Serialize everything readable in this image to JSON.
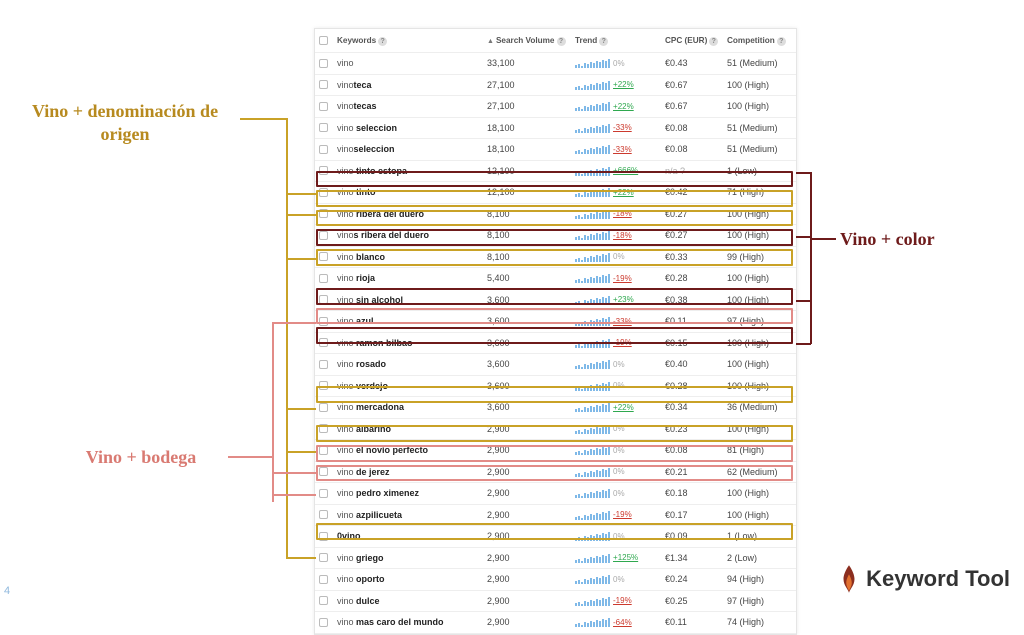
{
  "labels": {
    "denominacion": "Vino + denominación de origen",
    "bodega": "Vino + bodega",
    "color": "Vino + color"
  },
  "header": {
    "keywords": "Keywords",
    "search_volume": "Search Volume",
    "trend": "Trend",
    "cpc": "CPC (EUR)",
    "competition": "Competition"
  },
  "rows": [
    {
      "plain": "vino",
      "bold": "",
      "vol": "33,100",
      "trend_pct": "0%",
      "trend_dir": "0",
      "cpc": "€0.43",
      "comp": "51 (Medium)",
      "hl": ""
    },
    {
      "plain": "vino",
      "bold": "teca",
      "vol": "27,100",
      "trend_pct": "+22%",
      "trend_dir": "up",
      "cpc": "€0.67",
      "comp": "100 (High)",
      "hl": ""
    },
    {
      "plain": "vino",
      "bold": "tecas",
      "vol": "27,100",
      "trend_pct": "+22%",
      "trend_dir": "up",
      "cpc": "€0.67",
      "comp": "100 (High)",
      "hl": ""
    },
    {
      "plain": "vino ",
      "bold": "seleccion",
      "vol": "18,100",
      "trend_pct": "-33%",
      "trend_dir": "dn",
      "cpc": "€0.08",
      "comp": "51 (Medium)",
      "hl": ""
    },
    {
      "plain": "vino",
      "bold": "seleccion",
      "vol": "18,100",
      "trend_pct": "-33%",
      "trend_dir": "dn",
      "cpc": "€0.08",
      "comp": "51 (Medium)",
      "hl": ""
    },
    {
      "plain": "vino ",
      "bold": "tinto estopa",
      "vol": "12,100",
      "trend_pct": "+666%",
      "trend_dir": "up",
      "cpc": "n/a ?",
      "comp": "1 (Low)",
      "hl": ""
    },
    {
      "plain": "vino ",
      "bold": "tinto",
      "vol": "12,100",
      "trend_pct": "+22%",
      "trend_dir": "up",
      "cpc": "€0.42",
      "comp": "71 (High)",
      "hl": "darkred"
    },
    {
      "plain": "vino ",
      "bold": "ribera del duero",
      "vol": "8,100",
      "trend_pct": "-18%",
      "trend_dir": "dn",
      "cpc": "€0.27",
      "comp": "100 (High)",
      "hl": "gold"
    },
    {
      "plain": "vino",
      "bold": "s ribera del duero",
      "vol": "8,100",
      "trend_pct": "-18%",
      "trend_dir": "dn",
      "cpc": "€0.27",
      "comp": "100 (High)",
      "hl": "gold"
    },
    {
      "plain": "vino ",
      "bold": "blanco",
      "vol": "8,100",
      "trend_pct": "0%",
      "trend_dir": "0",
      "cpc": "€0.33",
      "comp": "99 (High)",
      "hl": "darkred"
    },
    {
      "plain": "vino ",
      "bold": "rioja",
      "vol": "5,400",
      "trend_pct": "-19%",
      "trend_dir": "dn",
      "cpc": "€0.28",
      "comp": "100 (High)",
      "hl": "gold"
    },
    {
      "plain": "vino ",
      "bold": "sin alcohol",
      "vol": "3,600",
      "trend_pct": "+23%",
      "trend_dir": "up",
      "cpc": "€0.38",
      "comp": "100 (High)",
      "hl": ""
    },
    {
      "plain": "vino ",
      "bold": "azul",
      "vol": "3,600",
      "trend_pct": "-33%",
      "trend_dir": "dn",
      "cpc": "€0.11",
      "comp": "97 (High)",
      "hl": "darkred"
    },
    {
      "plain": "vino ",
      "bold": "ramon bilbao",
      "vol": "3,600",
      "trend_pct": "-19%",
      "trend_dir": "dn",
      "cpc": "€0.15",
      "comp": "100 (High)",
      "hl": "salmon"
    },
    {
      "plain": "vino ",
      "bold": "rosado",
      "vol": "3,600",
      "trend_pct": "0%",
      "trend_dir": "0",
      "cpc": "€0.40",
      "comp": "100 (High)",
      "hl": "darkred"
    },
    {
      "plain": "vino ",
      "bold": "verdejo",
      "vol": "3,600",
      "trend_pct": "0%",
      "trend_dir": "0",
      "cpc": "€0.28",
      "comp": "100 (High)",
      "hl": ""
    },
    {
      "plain": "vino ",
      "bold": "mercadona",
      "vol": "3,600",
      "trend_pct": "+22%",
      "trend_dir": "up",
      "cpc": "€0.34",
      "comp": "36 (Medium)",
      "hl": ""
    },
    {
      "plain": "vino ",
      "bold": "albariño",
      "vol": "2,900",
      "trend_pct": "0%",
      "trend_dir": "0",
      "cpc": "€0.23",
      "comp": "100 (High)",
      "hl": "gold"
    },
    {
      "plain": "vino ",
      "bold": "el novio perfecto",
      "vol": "2,900",
      "trend_pct": "0%",
      "trend_dir": "0",
      "cpc": "€0.08",
      "comp": "81 (High)",
      "hl": ""
    },
    {
      "plain": "vino ",
      "bold": "de jerez",
      "vol": "2,900",
      "trend_pct": "0%",
      "trend_dir": "0",
      "cpc": "€0.21",
      "comp": "62 (Medium)",
      "hl": "gold"
    },
    {
      "plain": "vino ",
      "bold": "pedro ximenez",
      "vol": "2,900",
      "trend_pct": "0%",
      "trend_dir": "0",
      "cpc": "€0.18",
      "comp": "100 (High)",
      "hl": "salmon"
    },
    {
      "plain": "vino ",
      "bold": "azpilicueta",
      "vol": "2,900",
      "trend_pct": "-19%",
      "trend_dir": "dn",
      "cpc": "€0.17",
      "comp": "100 (High)",
      "hl": "salmon"
    },
    {
      "plain": "",
      "bold": "0vino",
      "vol": "2,900",
      "trend_pct": "0%",
      "trend_dir": "0",
      "cpc": "€0.09",
      "comp": "1 (Low)",
      "hl": ""
    },
    {
      "plain": "vino ",
      "bold": "griego",
      "vol": "2,900",
      "trend_pct": "+125%",
      "trend_dir": "up",
      "cpc": "€1.34",
      "comp": "2 (Low)",
      "hl": ""
    },
    {
      "plain": "vino ",
      "bold": "oporto",
      "vol": "2,900",
      "trend_pct": "0%",
      "trend_dir": "0",
      "cpc": "€0.24",
      "comp": "94 (High)",
      "hl": "gold"
    },
    {
      "plain": "vino ",
      "bold": "dulce",
      "vol": "2,900",
      "trend_pct": "-19%",
      "trend_dir": "dn",
      "cpc": "€0.25",
      "comp": "97 (High)",
      "hl": ""
    },
    {
      "plain": "vino ",
      "bold": "mas caro del mundo",
      "vol": "2,900",
      "trend_pct": "-64%",
      "trend_dir": "dn",
      "cpc": "€0.11",
      "comp": "74 (High)",
      "hl": ""
    }
  ],
  "logo": "Keyword Tool",
  "page_num": "4"
}
